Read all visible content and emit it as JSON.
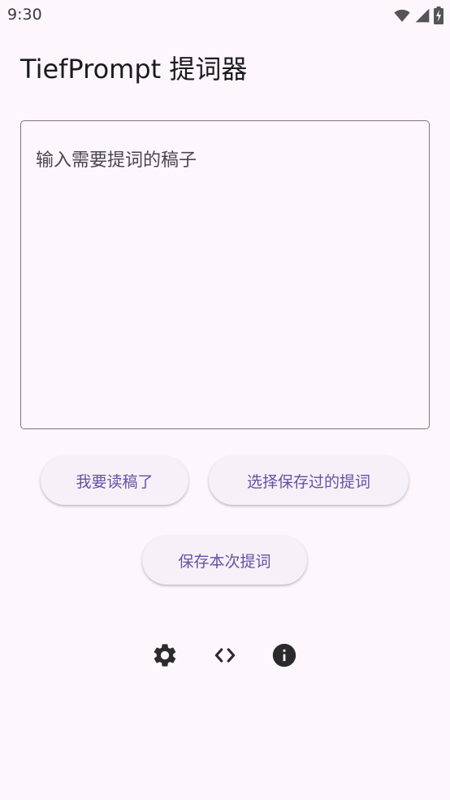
{
  "status_bar": {
    "time": "9:30",
    "icons": [
      "wifi-icon",
      "cellular-signal-icon",
      "battery-charging-icon"
    ]
  },
  "app": {
    "title": "TiefPrompt 提词器"
  },
  "script_input": {
    "value": "",
    "placeholder": "输入需要提词的稿子"
  },
  "buttons": {
    "read": "我要读稿了",
    "select_saved": "选择保存过的提词",
    "save_current": "保存本次提词"
  },
  "footer_icons": [
    "settings-icon",
    "code-icon",
    "info-icon"
  ],
  "colors": {
    "background": "#fdf7fd",
    "button_background": "#f6f1f8",
    "button_text": "#6750a4",
    "icon": "#2b2b2b",
    "outline": "#7a757f"
  }
}
